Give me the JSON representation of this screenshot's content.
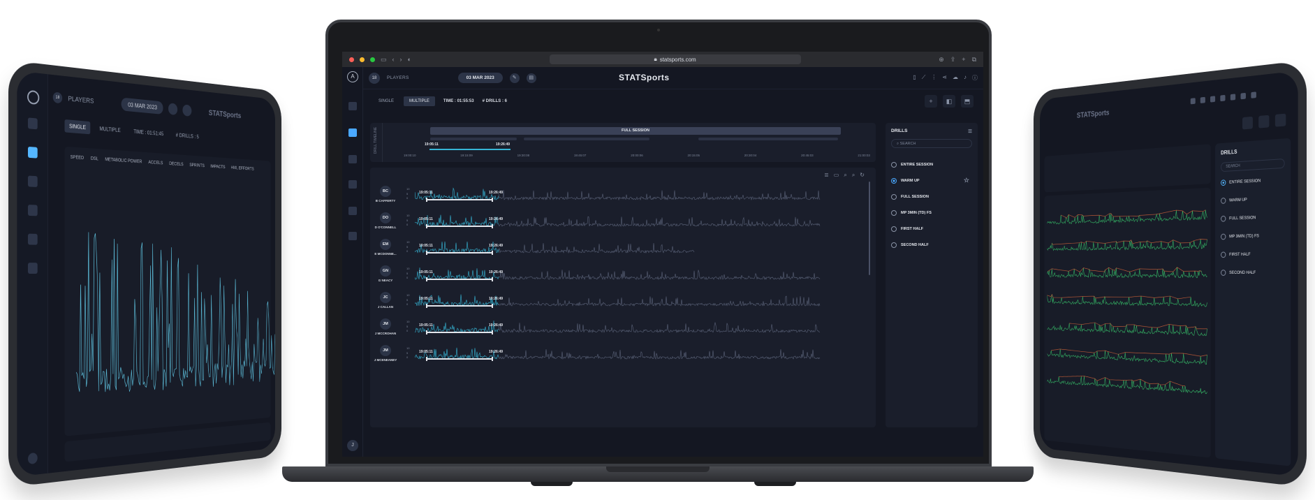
{
  "colors": {
    "accent": "#4aa8ff",
    "trace": "#36b6d6",
    "background": "#141722",
    "panel": "#1a1e2b"
  },
  "browser": {
    "url": "statsports.com"
  },
  "app": {
    "brand": "STATSports",
    "players_count": "18",
    "players_label": "PLAYERS",
    "date": "03 MAR 2023",
    "user_initial": "J",
    "modes": [
      "SINGLE",
      "MULTIPLE"
    ],
    "selected_mode": "MULTIPLE",
    "time": "TIME : 01:55:53",
    "drills_count": "# DRILLS : 6"
  },
  "timeline": {
    "label": "DRILL TIMELINE",
    "full_session": "FULL SESSION",
    "sel_start": "19:05:11",
    "sel_end": "19:26:49",
    "ticks": [
      "19:00:10",
      "19:15:09",
      "19:30:08",
      "19:45:07",
      "20:00:06",
      "20:15:05",
      "20:30:04",
      "20:45:03",
      "21:00:03"
    ]
  },
  "axis_ticks": [
    "10",
    "5",
    "0"
  ],
  "players": [
    {
      "initials": "BC",
      "name": "B CAFFERTY",
      "start": "19:05:11",
      "end": "19:26:49"
    },
    {
      "initials": "DO",
      "name": "D O'CONNELL",
      "start": "19:05:11",
      "end": "19:26:49"
    },
    {
      "initials": "EM",
      "name": "E MCDONNE...",
      "start": "19:05:11",
      "end": "19:26:49"
    },
    {
      "initials": "GN",
      "name": "G NEACY",
      "start": "19:05:11",
      "end": "19:26:49"
    },
    {
      "initials": "JC",
      "name": "J CALLAN",
      "start": "19:05:11",
      "end": "19:26:49"
    },
    {
      "initials": "JM",
      "name": "J MCCROHAN",
      "start": "19:05:11",
      "end": "19:26:49"
    },
    {
      "initials": "JM",
      "name": "J MCENEANEY",
      "start": "19:05:11",
      "end": "19:26:49"
    }
  ],
  "drills": {
    "title": "DRILLS",
    "search_placeholder": "SEARCH",
    "items": [
      "ENTIRE SESSION",
      "WARM UP",
      "FULL SESSION",
      "MP 3MIN (TD) FS",
      "FIRST HALF",
      "SECOND HALF"
    ],
    "selected": "WARM UP"
  },
  "left_tablet": {
    "time": "TIME : 01:51:45",
    "drills": "# DRILLS : 5",
    "legend": [
      "SPEED",
      "DSL",
      "METABOLIC POWER",
      "ACCELS",
      "DECELS",
      "SPRINTS",
      "IMPACTS",
      "HML EFFORTS"
    ]
  },
  "right_tablet": {
    "drills_title": "DRILLS",
    "items": [
      "ENTIRE SESSION",
      "WARM UP",
      "FULL SESSION",
      "MP 3MIN (TD) FS",
      "FIRST HALF",
      "SECOND HALF"
    ]
  }
}
